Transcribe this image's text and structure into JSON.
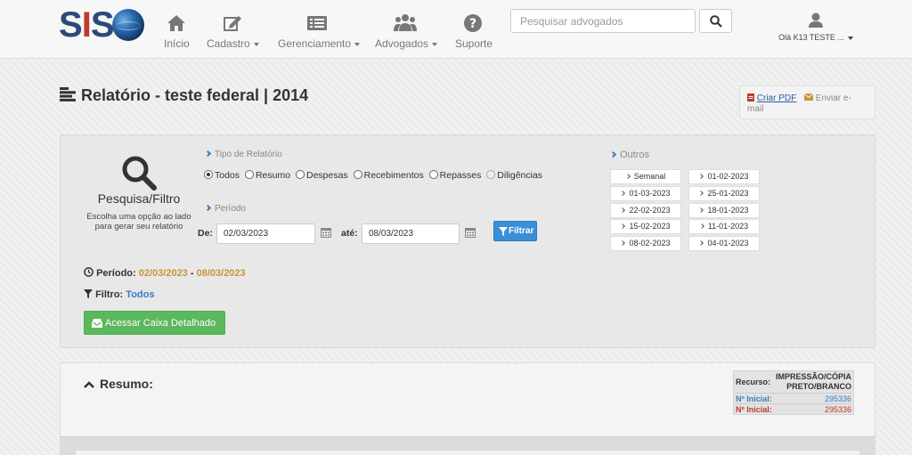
{
  "nav": {
    "logo": "SIS",
    "items": [
      {
        "label": "Início",
        "icon": "home-icon",
        "dropdown": false
      },
      {
        "label": "Cadastro",
        "icon": "edit-icon",
        "dropdown": true
      },
      {
        "label": "Gerenciamento",
        "icon": "list-icon",
        "dropdown": true
      },
      {
        "label": "Advogados",
        "icon": "users-icon",
        "dropdown": true
      },
      {
        "label": "Suporte",
        "icon": "question-icon",
        "dropdown": false
      }
    ],
    "search_placeholder": "Pesquisar advogados",
    "user_label": "Olá K13 TESTE ..."
  },
  "page": {
    "title": "Relatório - teste federal | 2014",
    "pdf_label": "Criar PDF",
    "email_label": "Enviar e-mail"
  },
  "filter": {
    "title": "Pesquisa/Filtro",
    "description": "Escolha uma opção ao lado para gerar seu relatório",
    "report_type_label": "Tipo de Relatório",
    "report_types": [
      {
        "label": "Todos",
        "checked": true,
        "disabled": false
      },
      {
        "label": "Resumo",
        "checked": false,
        "disabled": false
      },
      {
        "label": "Despesas",
        "checked": false,
        "disabled": false
      },
      {
        "label": "Recebimentos",
        "checked": false,
        "disabled": false
      },
      {
        "label": "Repasses",
        "checked": false,
        "disabled": false
      },
      {
        "label": "Diligências",
        "checked": false,
        "disabled": true
      }
    ],
    "period_label": "Período",
    "from_label": "De:",
    "from_value": "02/03/2023",
    "to_label": "até:",
    "to_value": "08/03/2023",
    "filter_button": "Filtrar",
    "others_label": "Outros",
    "others_col1": [
      "Semanal",
      "01-03-2023",
      "22-02-2023",
      "15-02-2023",
      "08-02-2023"
    ],
    "others_col2": [
      "01-02-2023",
      "25-01-2023",
      "18-01-2023",
      "11-01-2023",
      "04-01-2023"
    ],
    "period_info_label": "Período:",
    "period_info_from": "02/03/2023",
    "period_info_sep": "-",
    "period_info_to": "08/03/2023",
    "filter_info_label": "Filtro:",
    "filter_info_value": "Todos",
    "caixa_button": "Acessar Caixa Detalhado"
  },
  "resumo": {
    "title": "Resumo:",
    "recurso_label": "Recurso:",
    "recurso_value": "IMPRESSÃO/CÓPIA PRETO/BRANCO",
    "rows": [
      {
        "label": "Nº Inicial:",
        "value": "295336",
        "color": "#3a7bbf"
      },
      {
        "label": "Nº Inicial:",
        "value": "295336",
        "color": "#c0392b"
      }
    ]
  }
}
